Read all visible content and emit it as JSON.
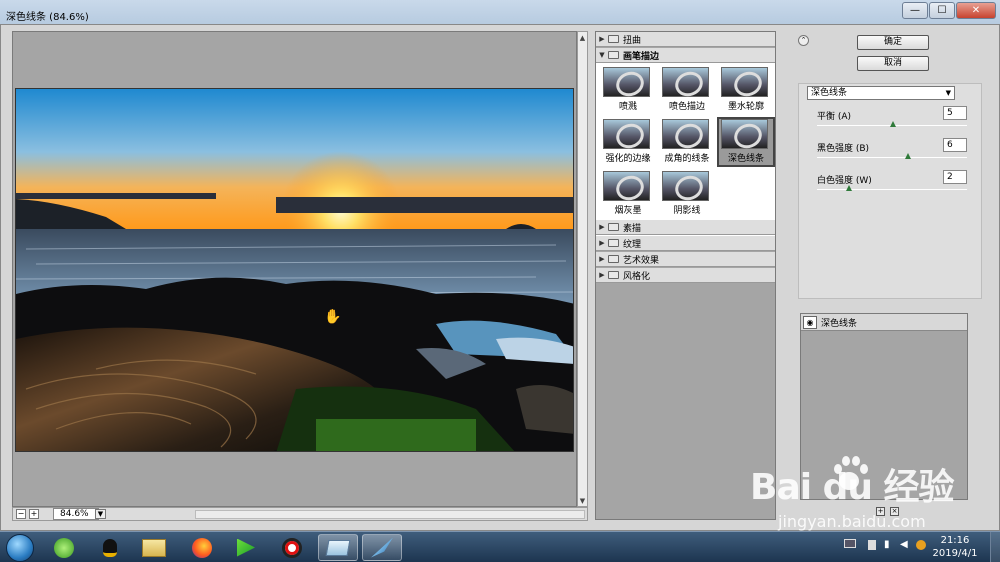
{
  "window": {
    "title": "深色线条 (84.6%)",
    "minimize": "—",
    "maximize": "☐",
    "close": "✕"
  },
  "preview": {
    "zoom_minus": "−",
    "zoom_plus": "+",
    "zoom_value": "84.6%"
  },
  "filter_gallery": {
    "categories_top": [
      {
        "label": "扭曲",
        "expanded": false
      },
      {
        "label": "画笔描边",
        "expanded": true
      }
    ],
    "thumbnails": [
      {
        "label": "喷溅",
        "selected": false
      },
      {
        "label": "喷色描边",
        "selected": false
      },
      {
        "label": "墨水轮廓",
        "selected": false
      },
      {
        "label": "强化的边缘",
        "selected": false
      },
      {
        "label": "成角的线条",
        "selected": false
      },
      {
        "label": "深色线条",
        "selected": true
      },
      {
        "label": "烟灰墨",
        "selected": false
      },
      {
        "label": "阴影线",
        "selected": false
      }
    ],
    "categories_bottom": [
      {
        "label": "素描"
      },
      {
        "label": "纹理"
      },
      {
        "label": "艺术效果"
      },
      {
        "label": "风格化"
      }
    ]
  },
  "buttons": {
    "ok": "确定",
    "cancel": "取消",
    "collapse": "⌃"
  },
  "settings": {
    "selected_filter": "深色线条",
    "params": [
      {
        "label": "平衡 (A)",
        "value": "5",
        "level": 0.5
      },
      {
        "label": "黑色强度 (B)",
        "value": "6",
        "level": 0.6
      },
      {
        "label": "白色强度 (W)",
        "value": "2",
        "level": 0.2
      }
    ]
  },
  "layers": {
    "items": [
      {
        "label": "深色线条"
      }
    ]
  },
  "taskbar": {
    "clock_time": "21:16",
    "clock_date": "2019/4/1"
  },
  "watermark": {
    "text": "Bai du 经验",
    "url": "jingyan.baidu.com"
  },
  "colors": {
    "accent": "#2f7a3a",
    "panel": "#d6d6d6",
    "canvas": "#a5a5a5"
  }
}
